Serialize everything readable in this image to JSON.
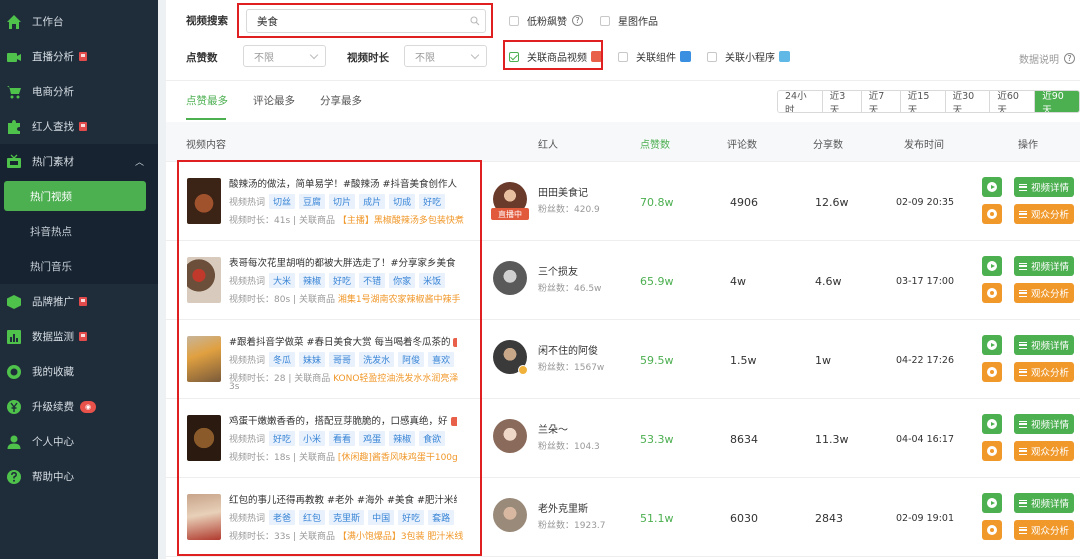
{
  "sidebar": {
    "items": [
      {
        "label": "工作台",
        "icon": "home-icon"
      },
      {
        "label": "直播分析",
        "icon": "live-camera-icon",
        "flag": true
      },
      {
        "label": "电商分析",
        "icon": "cart-icon"
      },
      {
        "label": "红人查找",
        "icon": "puzzle-icon",
        "flag": true
      },
      {
        "label": "热门素材",
        "icon": "tv-icon",
        "expanded": true
      },
      {
        "label": "品牌推广",
        "icon": "cube-icon",
        "flag": true
      },
      {
        "label": "数据监测",
        "icon": "bar-chart-icon",
        "flag": true
      },
      {
        "label": "我的收藏",
        "icon": "bookmark-icon"
      },
      {
        "label": "升级续费",
        "icon": "yen-icon"
      },
      {
        "label": "个人中心",
        "icon": "user-icon"
      },
      {
        "label": "帮助中心",
        "icon": "help-icon"
      }
    ],
    "sub_items": [
      "热门视频",
      "抖音热点",
      "热门音乐"
    ],
    "active_sub": "热门视频"
  },
  "filters": {
    "search_label": "视频搜索",
    "search_value": "美食",
    "low_fans_label": "低粉飙赞",
    "picture_label": "星图作品",
    "likes_label": "点赞数",
    "likes_value": "不限",
    "duration_label": "视频时长",
    "duration_value": "不限",
    "linked_product_label": "关联商品视频",
    "linked_component_label": "关联组件",
    "linked_miniapp_label": "关联小程序",
    "data_desc": "数据说明"
  },
  "tabs": [
    "点赞最多",
    "评论最多",
    "分享最多"
  ],
  "ranges": [
    "24小时",
    "近3天",
    "近7天",
    "近15天",
    "近30天",
    "近60天",
    "近90天"
  ],
  "active_range": "近90天",
  "columns": {
    "content": "视频内容",
    "kol": "红人",
    "likes": "点赞数",
    "comments": "评论数",
    "shares": "分享数",
    "time": "发布时间",
    "ops": "操作"
  },
  "row_labels": {
    "keywords": "视频热词",
    "duration_prefix": "视频时长：",
    "product_prefix": "关联商品",
    "fans_prefix": "粉丝数：",
    "detail_btn": "视频详情",
    "audience_btn": "观众分析",
    "live_tag": "直播中"
  },
  "rows": [
    {
      "title": "酸辣汤的做法，简单易学！#酸辣汤 #抖音美食创作人",
      "keywords": [
        "切丝",
        "豆腐",
        "切片",
        "成片",
        "切成",
        "好吃"
      ],
      "duration": "41s",
      "product": "【主播】黑椒酸辣汤多包装快煮",
      "kol": "田田美食记",
      "fans": "420.9",
      "likes": "70.8w",
      "comments": "4906",
      "shares": "12.6w",
      "time": "02-09 20:35"
    },
    {
      "title": "表哥每次花里胡哨的都被大胖选走了！#分享家乡美食",
      "keywords": [
        "大米",
        "辣椒",
        "好吃",
        "不错",
        "你家",
        "米饭"
      ],
      "duration": "80s",
      "product": "湘集1号湖南农家辣椒酱中辣手",
      "kol": "三个损友",
      "fans": "46.5w",
      "likes": "65.9w",
      "comments": "4w",
      "shares": "4.6w",
      "time": "03-17 17:00"
    },
    {
      "title": "#跟着抖音学做菜 #春日美食大赏 每当喝着冬瓜茶的",
      "keywords": [
        "冬瓜",
        "妹妹",
        "哥哥",
        "洗发水",
        "阿俊",
        "喜欢"
      ],
      "duration": "28",
      "duration_wrap": "3s",
      "product": "KONO轻盈控油洗发水水润亮泽",
      "kol": "闲不住的阿俊",
      "fans": "1567w",
      "likes": "59.5w",
      "comments": "1.5w",
      "shares": "1w",
      "time": "04-22 17:26"
    },
    {
      "title": "鸡蛋干嫩嫩香香的，搭配豆芽脆脆的，口感真绝，好",
      "keywords": [
        "好吃",
        "小米",
        "看看",
        "鸡蛋",
        "辣椒",
        "食欲"
      ],
      "duration": "18s",
      "product": "[休闲趣]酱香风味鸡蛋干100g",
      "kol": "兰朵～",
      "fans": "104.3",
      "likes": "53.3w",
      "comments": "8634",
      "shares": "11.3w",
      "time": "04-04 16:17"
    },
    {
      "title": "红包的事儿还得再教教 #老外 #海外 #美食 #肥汁米线",
      "keywords": [
        "老爸",
        "红包",
        "克里斯",
        "中国",
        "好吃",
        "套路"
      ],
      "duration": "33s",
      "product": "【满小饱爆品】3包装 肥汁米线",
      "kol": "老外克里斯",
      "fans": "1923.7",
      "likes": "51.1w",
      "comments": "6030",
      "shares": "2843",
      "time": "02-09 19:01"
    }
  ],
  "colors": {
    "accent": "#4caf50",
    "orange": "#f0982a",
    "sidebar_bg": "#1f2d3a",
    "highlight_box": "#e02020"
  }
}
